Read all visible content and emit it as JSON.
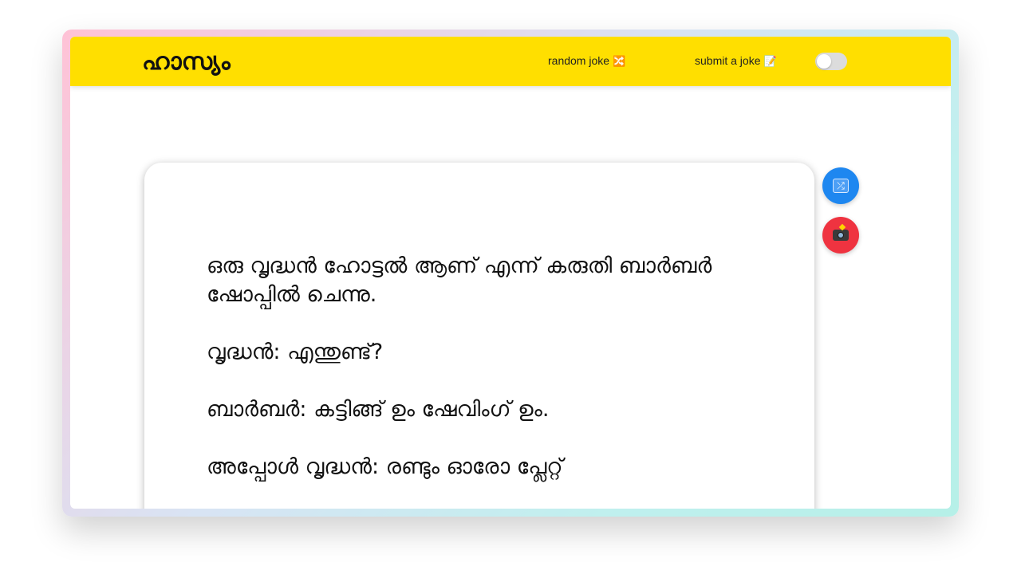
{
  "brand": {
    "title": "ഹാസ്യം"
  },
  "nav": {
    "random_label": "random joke",
    "random_emoji": "🔀",
    "submit_label": "submit a joke",
    "submit_emoji": "📝"
  },
  "theme_toggle": {
    "state": "off"
  },
  "joke": {
    "lines": [
      "ഒരു വൃദ്ധൻ ഹോട്ടൽ ആണ് എന്ന് കരുതി ബാർബർ ഷോപ്പിൽ ചെന്നു.",
      "വൃദ്ധൻ: എന്തുണ്ട്?",
      "ബാർബർ: കട്ടിങ്ങ് ഉം ഷേവിംഗ് ഉം.",
      "അപ്പോൾ വൃദ്ധൻ: രണ്ടും ഓരോ പ്ലേറ്റ്"
    ]
  },
  "actions": {
    "shuffle_icon": "shuffle-icon",
    "screenshot_icon": "camera-icon"
  },
  "colors": {
    "navbar": "#ffdf00",
    "shuffle_button": "#1e87f0",
    "screenshot_button": "#ef3340"
  }
}
